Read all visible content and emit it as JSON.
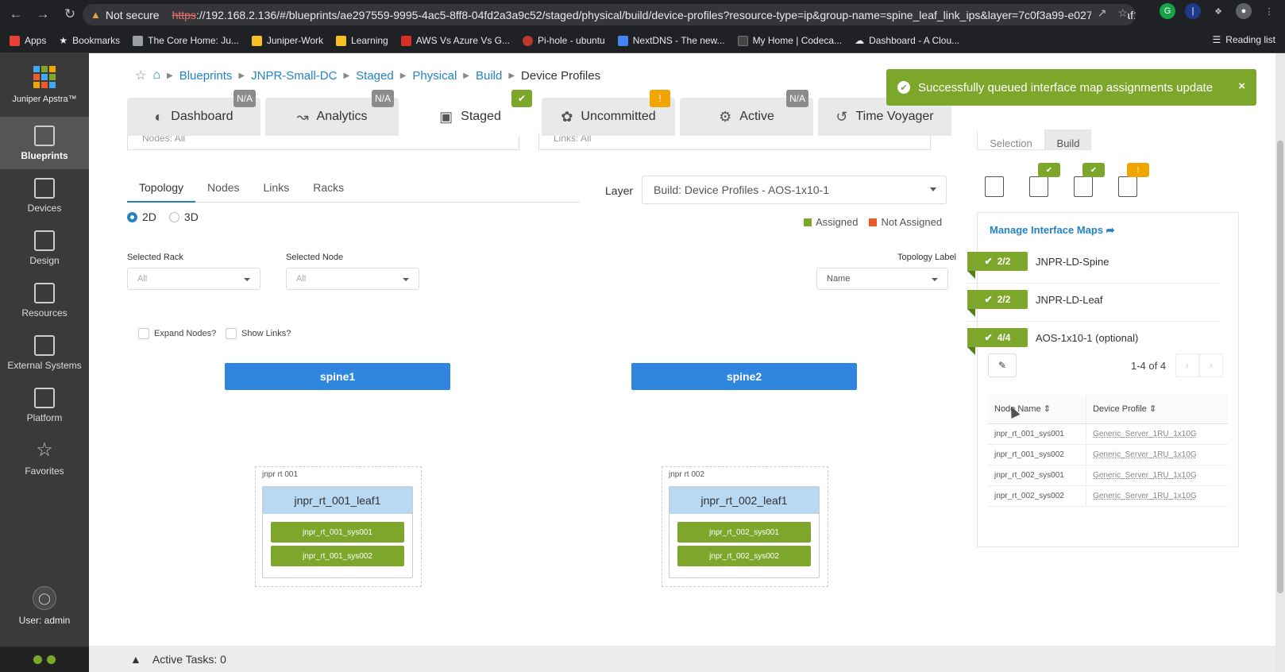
{
  "browser": {
    "not_secure": "Not secure",
    "url_scheme": "https",
    "url_rest": "://192.168.2.136/#/blueprints/ae297559-9995-4ac5-8ff8-04fd2a3a9c52/staged/physical/build/device-profiles?resource-type=ip&group-name=spine_leaf_link_ips&layer=7c0f3a99-e027-468c-af1...",
    "bookmarks": [
      {
        "label": "Apps",
        "color": "#e94235"
      },
      {
        "label": "Bookmarks",
        "color": "#e8eaed"
      },
      {
        "label": "The Core Home: Ju...",
        "color": "#9aa0a6"
      },
      {
        "label": "Juniper-Work",
        "color": "#f6bf26"
      },
      {
        "label": "Learning",
        "color": "#f6bf26"
      },
      {
        "label": "AWS Vs Azure Vs G...",
        "color": "#d93025"
      },
      {
        "label": "Pi-hole - ubuntu",
        "color": "#c0392b"
      },
      {
        "label": "NextDNS - The new...",
        "color": "#4285f4"
      },
      {
        "label": "My Home | Codeca...",
        "color": "#444"
      },
      {
        "label": "Dashboard - A Clou...",
        "color": "#e8eaed"
      }
    ],
    "reading_list": "Reading list"
  },
  "sidebar": {
    "brand": "Juniper Apstra™",
    "items": [
      {
        "label": "Blueprints",
        "icon": "blueprints-icon",
        "active": true
      },
      {
        "label": "Devices",
        "icon": "devices-icon"
      },
      {
        "label": "Design",
        "icon": "design-icon"
      },
      {
        "label": "Resources",
        "icon": "resources-icon"
      },
      {
        "label": "External Systems",
        "icon": "external-systems-icon"
      },
      {
        "label": "Platform",
        "icon": "platform-icon"
      },
      {
        "label": "Favorites",
        "icon": "star-icon"
      }
    ],
    "user": "User: admin"
  },
  "breadcrumb": {
    "items": [
      "Blueprints",
      "JNPR-Small-DC",
      "Staged",
      "Physical",
      "Build"
    ],
    "current": "Device Profiles"
  },
  "tabs": [
    {
      "label": "Dashboard",
      "badge": "N/A",
      "badge_type": "na"
    },
    {
      "label": "Analytics",
      "badge": "N/A",
      "badge_type": "na"
    },
    {
      "label": "Staged",
      "badge": "✔",
      "badge_type": "ok"
    },
    {
      "label": "Uncommitted",
      "badge": "!",
      "badge_type": "warn"
    },
    {
      "label": "Active",
      "badge": "N/A",
      "badge_type": "na"
    },
    {
      "label": "Time Voyager",
      "badge": "",
      "badge_type": ""
    }
  ],
  "toast": {
    "message": "Successfully queued interface map assignments update",
    "close": "×"
  },
  "filters": {
    "nodes": "Nodes: All",
    "links": "Links: All"
  },
  "subtabs": [
    "Topology",
    "Nodes",
    "Links",
    "Racks"
  ],
  "view_mode": {
    "2d": "2D",
    "3d": "3D"
  },
  "layer": {
    "label": "Layer",
    "value": "Build: Device Profiles - AOS-1x10-1"
  },
  "legend": {
    "assigned": "Assigned",
    "not_assigned": "Not Assigned",
    "assigned_color": "#7da72b",
    "not_assigned_color": "#f05a28"
  },
  "selectors": {
    "rack_label": "Selected Rack",
    "rack_value": "All",
    "node_label": "Selected Node",
    "node_value": "All",
    "topology_label": "Topology Label",
    "topology_value": "Name"
  },
  "checks": {
    "expand": "Expand Nodes?",
    "show_links": "Show Links?"
  },
  "topology": {
    "spines": [
      "spine1",
      "spine2"
    ],
    "racks": [
      {
        "label": "jnpr rt 001",
        "leaf": "jnpr_rt_001_leaf1",
        "systems": [
          "jnpr_rt_001_sys001",
          "jnpr_rt_001_sys002"
        ]
      },
      {
        "label": "jnpr rt 002",
        "leaf": "jnpr_rt_002_leaf1",
        "systems": [
          "jnpr_rt_002_sys001",
          "jnpr_rt_002_sys002"
        ]
      }
    ]
  },
  "right_panel": {
    "tabs": [
      "Selection",
      "Build"
    ],
    "icon_badges": [
      {
        "icon": "list-icon",
        "badge": "✔",
        "type": "ok"
      },
      {
        "icon": "server-rack-icon",
        "badge": "✔",
        "type": "ok"
      },
      {
        "icon": "device-profile-icon",
        "badge": "!",
        "type": "warn"
      },
      {
        "icon": "hierarchy-icon",
        "badge": "✔",
        "type": "ok"
      }
    ],
    "manage_link": "Manage Interface Maps",
    "interface_maps": [
      {
        "count": "2/2",
        "name": "JNPR-LD-Spine"
      },
      {
        "count": "2/2",
        "name": "JNPR-LD-Leaf"
      },
      {
        "count": "4/4",
        "name": "AOS-1x10-1 (optional)"
      }
    ],
    "pager": "1-4 of 4",
    "table": {
      "headers": [
        "Node Name",
        "Device Profile"
      ],
      "rows": [
        [
          "jnpr_rt_001_sys001",
          "Generic_Server_1RU_1x10G"
        ],
        [
          "jnpr_rt_001_sys002",
          "Generic_Server_1RU_1x10G"
        ],
        [
          "jnpr_rt_002_sys001",
          "Generic_Server_1RU_1x10G"
        ],
        [
          "jnpr_rt_002_sys002",
          "Generic_Server_1RU_1x10G"
        ]
      ]
    }
  },
  "footer": {
    "active_tasks": "Active Tasks: 0"
  }
}
